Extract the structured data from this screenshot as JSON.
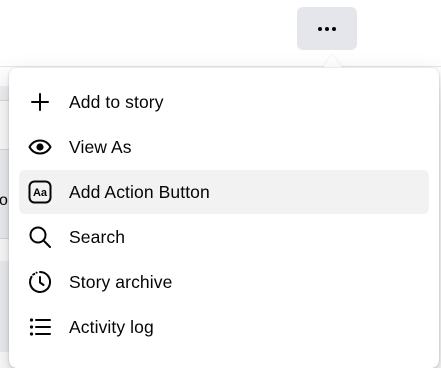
{
  "more_button": {
    "icon": "more-horizontal-icon"
  },
  "background": {
    "fragment_text": "o,"
  },
  "menu": {
    "items": [
      {
        "label": "Add to story",
        "icon": "plus-icon",
        "highlighted": false
      },
      {
        "label": "View As",
        "icon": "eye-icon",
        "highlighted": false
      },
      {
        "label": "Add Action Button",
        "icon": "action-button-icon",
        "highlighted": true
      },
      {
        "label": "Search",
        "icon": "search-icon",
        "highlighted": false
      },
      {
        "label": "Story archive",
        "icon": "story-archive-icon",
        "highlighted": false
      },
      {
        "label": "Activity log",
        "icon": "activity-log-icon",
        "highlighted": false
      }
    ]
  },
  "colors": {
    "button_bg": "#e4e6eb",
    "highlight_bg": "#f2f2f2",
    "text": "#050505"
  }
}
